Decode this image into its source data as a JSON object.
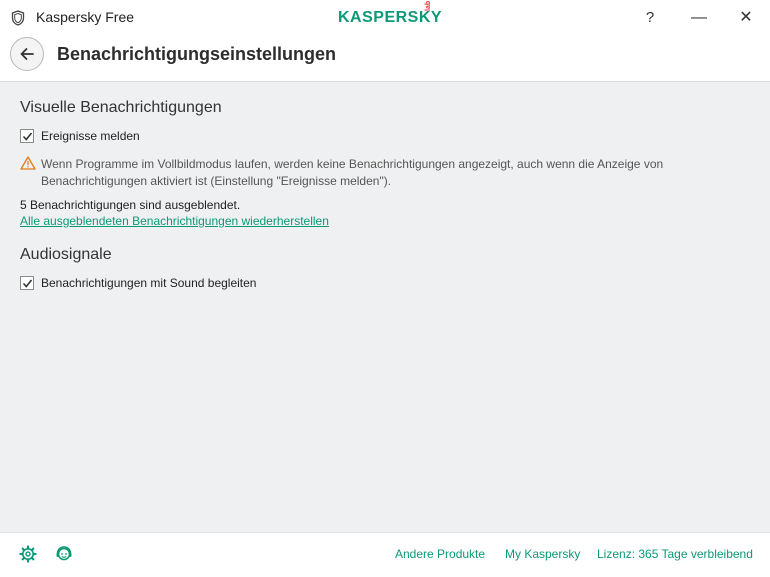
{
  "window": {
    "title": "Kaspersky Free",
    "logo_text": "KASPERSKY",
    "logo_badge": "lab",
    "help_label": "?",
    "minimize_label": "—",
    "close_label": "✕"
  },
  "header": {
    "title": "Benachrichtigungseinstellungen"
  },
  "visual": {
    "section_title": "Visuelle Benachrichtigungen",
    "report_events": {
      "label": "Ereignisse melden",
      "checked": true
    },
    "warning": "Wenn Programme im Vollbildmodus laufen, werden keine Benachrichtigungen angezeigt, auch wenn die Anzeige von Benachrichtigungen aktiviert ist (Einstellung \"Ereignisse melden\").",
    "hidden_count": "5 Benachrichtigungen sind ausgeblendet.",
    "restore_link": "Alle ausgeblendeten Benachrichtigungen wiederherstellen"
  },
  "audio": {
    "section_title": "Audiosignale",
    "sound": {
      "label": "Benachrichtigungen mit Sound begleiten",
      "checked": true
    }
  },
  "footer": {
    "icons": [
      "gear-icon",
      "support-agent-icon"
    ],
    "links": [
      "Andere Produkte",
      "My Kaspersky",
      "Lizenz: 365 Tage verbleibend"
    ]
  },
  "colors": {
    "accent": "#0b9a77",
    "warning": "#e07b1a",
    "background": "#eff0f1"
  }
}
